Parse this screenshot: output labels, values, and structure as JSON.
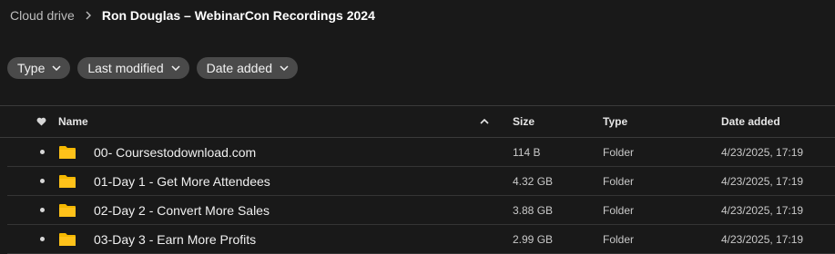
{
  "breadcrumb": {
    "root": "Cloud drive",
    "current": "Ron Douglas – WebinarCon Recordings 2024"
  },
  "filters": [
    {
      "label": "Type"
    },
    {
      "label": "Last modified"
    },
    {
      "label": "Date added"
    }
  ],
  "table": {
    "headers": {
      "name": "Name",
      "size": "Size",
      "type": "Type",
      "date_added": "Date added"
    },
    "rows": [
      {
        "name": "00- Coursestodownload.com",
        "size": "114 B",
        "type": "Folder",
        "date_added": "4/23/2025, 17:19"
      },
      {
        "name": "01-Day 1 - Get More Attendees",
        "size": "4.32 GB",
        "type": "Folder",
        "date_added": "4/23/2025, 17:19"
      },
      {
        "name": "02-Day 2 - Convert More Sales",
        "size": "3.88 GB",
        "type": "Folder",
        "date_added": "4/23/2025, 17:19"
      },
      {
        "name": "03-Day 3 - Earn More Profits",
        "size": "2.99 GB",
        "type": "Folder",
        "date_added": "4/23/2025, 17:19"
      }
    ]
  },
  "colors": {
    "background": "#191919",
    "chip": "#4a4a4a",
    "folder": "#f5b800"
  }
}
